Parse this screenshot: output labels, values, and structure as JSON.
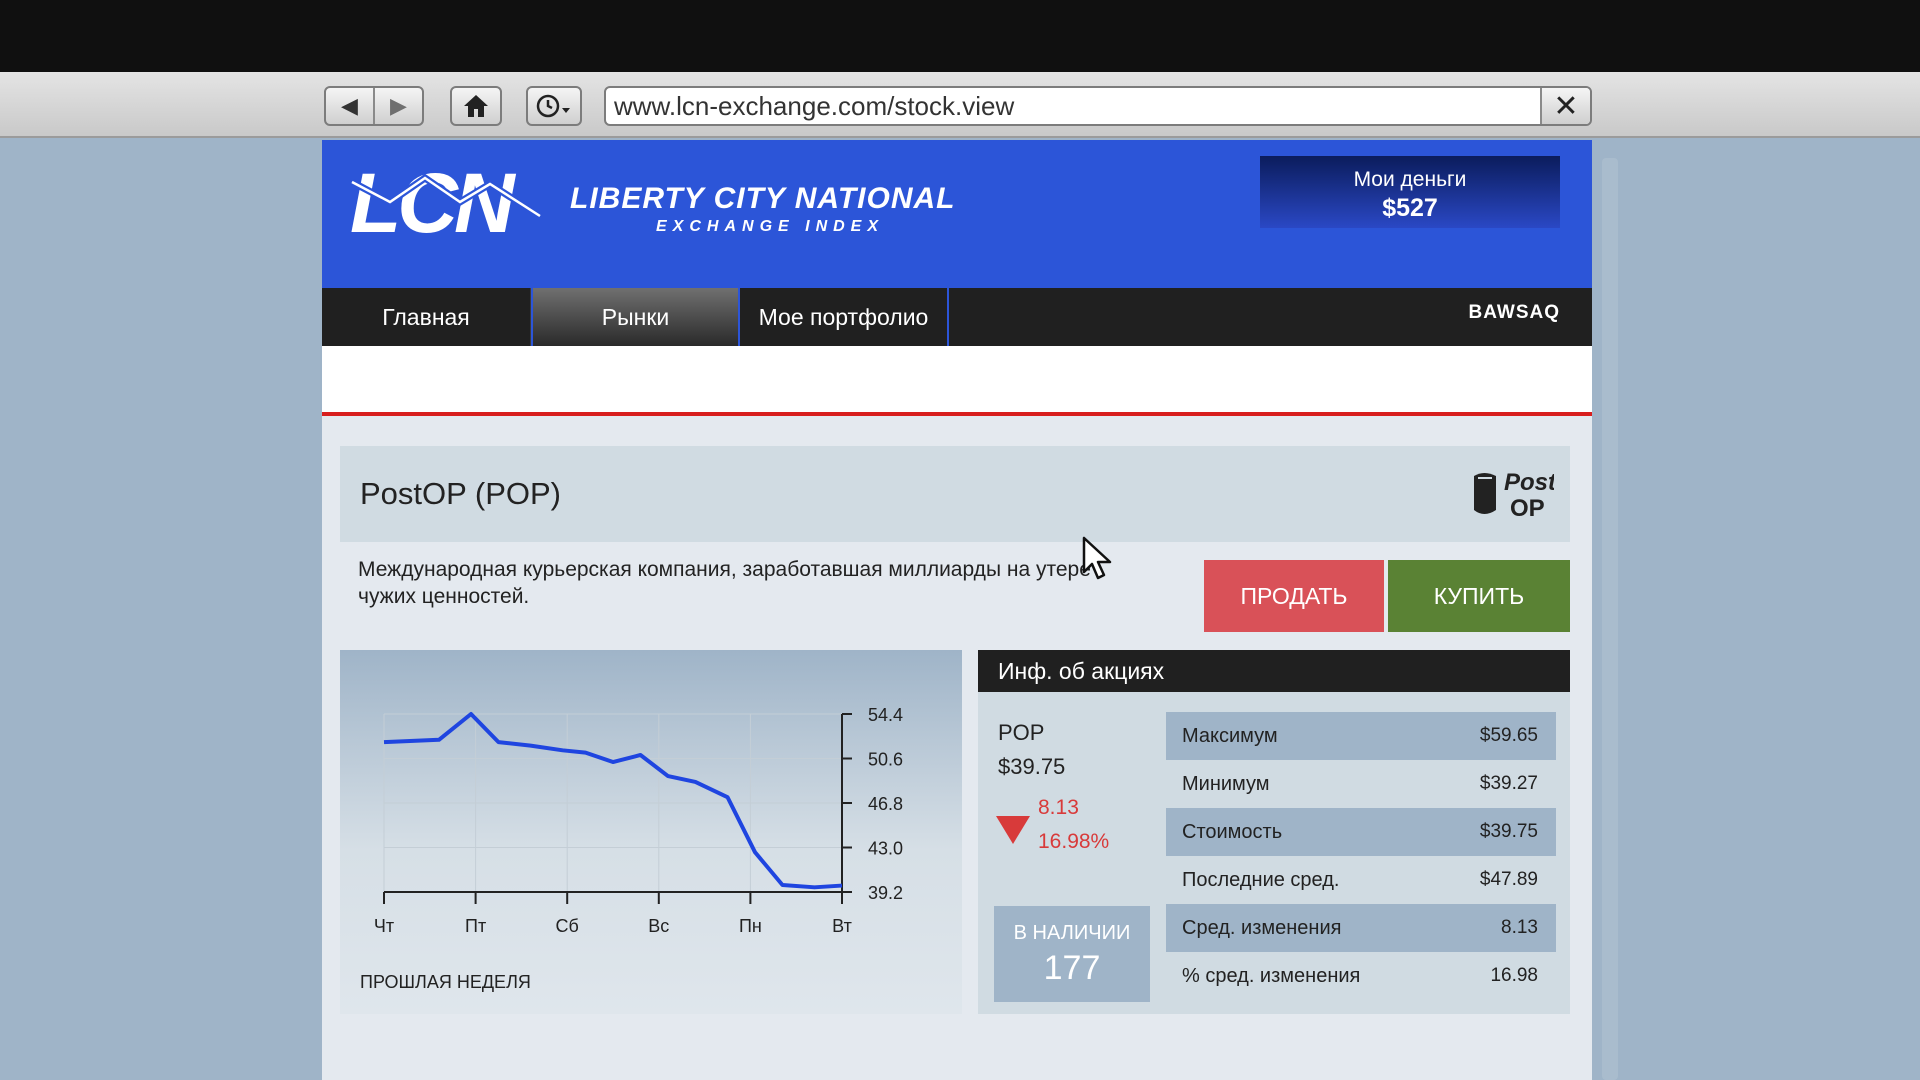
{
  "browser": {
    "url": "www.lcn-exchange.com/stock.view",
    "back_label": "◀",
    "forward_label": "▶",
    "close_label": "✕"
  },
  "header": {
    "logo_text": "LCN",
    "brand_name": "LIBERTY CITY NATIONAL",
    "brand_sub": "EXCHANGE INDEX",
    "money_label": "Мои деньги",
    "money_value": "$527"
  },
  "nav": {
    "tabs": [
      {
        "label": "Главная"
      },
      {
        "label": "Рынки"
      },
      {
        "label": "Мое портфолио"
      }
    ],
    "active_tab": "Рынки",
    "partner": "BAWSAQ"
  },
  "stock": {
    "title": "PostOP (POP)",
    "logo_text_1": "Post",
    "logo_text_2": "OP",
    "description": "Международная курьерская компания, заработавшая миллиарды на утере чужих ценностей.",
    "sell_label": "ПРОДАТЬ",
    "buy_label": "КУПИТЬ"
  },
  "chart_data": {
    "type": "line",
    "x": [
      "Чт",
      "Пт",
      "Сб",
      "Вс",
      "Пн",
      "Вт"
    ],
    "y_ticks": [
      "54.4",
      "50.6",
      "46.8",
      "43.0",
      "39.2"
    ],
    "ylim": [
      39.2,
      54.4
    ],
    "caption": "ПРОШЛАЯ НЕДЕЛЯ",
    "line_color": "#1f45e0",
    "series": [
      {
        "points": [
          [
            0.0,
            52.0
          ],
          [
            0.6,
            52.2
          ],
          [
            0.95,
            54.4
          ],
          [
            1.25,
            52.0
          ],
          [
            1.6,
            51.7
          ],
          [
            1.95,
            51.3
          ],
          [
            2.2,
            51.1
          ],
          [
            2.5,
            50.3
          ],
          [
            2.8,
            50.9
          ],
          [
            3.1,
            49.1
          ],
          [
            3.4,
            48.6
          ],
          [
            3.75,
            47.3
          ],
          [
            4.05,
            42.6
          ],
          [
            4.35,
            39.8
          ],
          [
            4.7,
            39.6
          ],
          [
            5.0,
            39.75
          ]
        ]
      }
    ]
  },
  "info": {
    "header": "Инф. об акциях",
    "ticker": "POP",
    "price": "$39.75",
    "change_abs": "8.13",
    "change_pct": "16.98%",
    "change_color": "#d83a3a",
    "stock_label": "В НАЛИЧИИ",
    "stock_count": "177",
    "stats": [
      {
        "label": "Максимум",
        "value": "$59.65"
      },
      {
        "label": "Минимум",
        "value": "$39.27"
      },
      {
        "label": "Стоимость",
        "value": "$39.75"
      },
      {
        "label": "Последние сред.",
        "value": "$47.89"
      },
      {
        "label": "Сред. изменения",
        "value": "8.13"
      },
      {
        "label": "% сред. изменения",
        "value": "16.98"
      }
    ]
  },
  "colors": {
    "header_blue": "#2c55d8",
    "sell_red": "#d95158",
    "buy_green": "#5a8234"
  }
}
